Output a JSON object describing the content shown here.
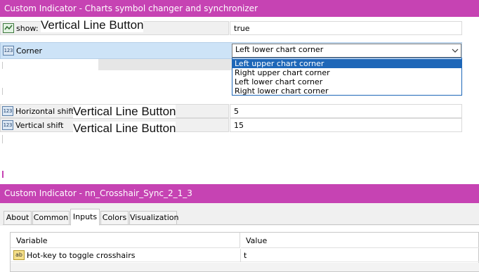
{
  "top_window": {
    "title": "Custom Indicator - Charts symbol changer and synchronizer"
  },
  "props": {
    "show": {
      "label": "show:",
      "value": "true"
    },
    "corner": {
      "label": "Corner",
      "value": "Left lower chart corner",
      "options": [
        "Left upper chart corner",
        "Right upper chart corner",
        "Left lower chart corner",
        "Right lower chart corner"
      ]
    },
    "hshift": {
      "label": "Horizontal shift",
      "value": "5"
    },
    "vshift": {
      "label": "Vertical shift",
      "value": "15"
    }
  },
  "overlay_text": "Vertical Line Button",
  "icons": {
    "int": "123"
  },
  "bottom_window": {
    "title": "Custom Indicator - nn_Crosshair_Sync_2_1_3",
    "tabs": [
      "About",
      "Common",
      "Inputs",
      "Colors",
      "Visualization"
    ],
    "active_tab": "Inputs",
    "columns": {
      "variable": "Variable",
      "value": "Value"
    },
    "rows": [
      {
        "icon": "ab",
        "variable": "Hot-key to toggle crosshairs",
        "value": "t"
      }
    ]
  },
  "colors": {
    "titlebar": "#c643b3",
    "selection": "#1e67b8"
  }
}
